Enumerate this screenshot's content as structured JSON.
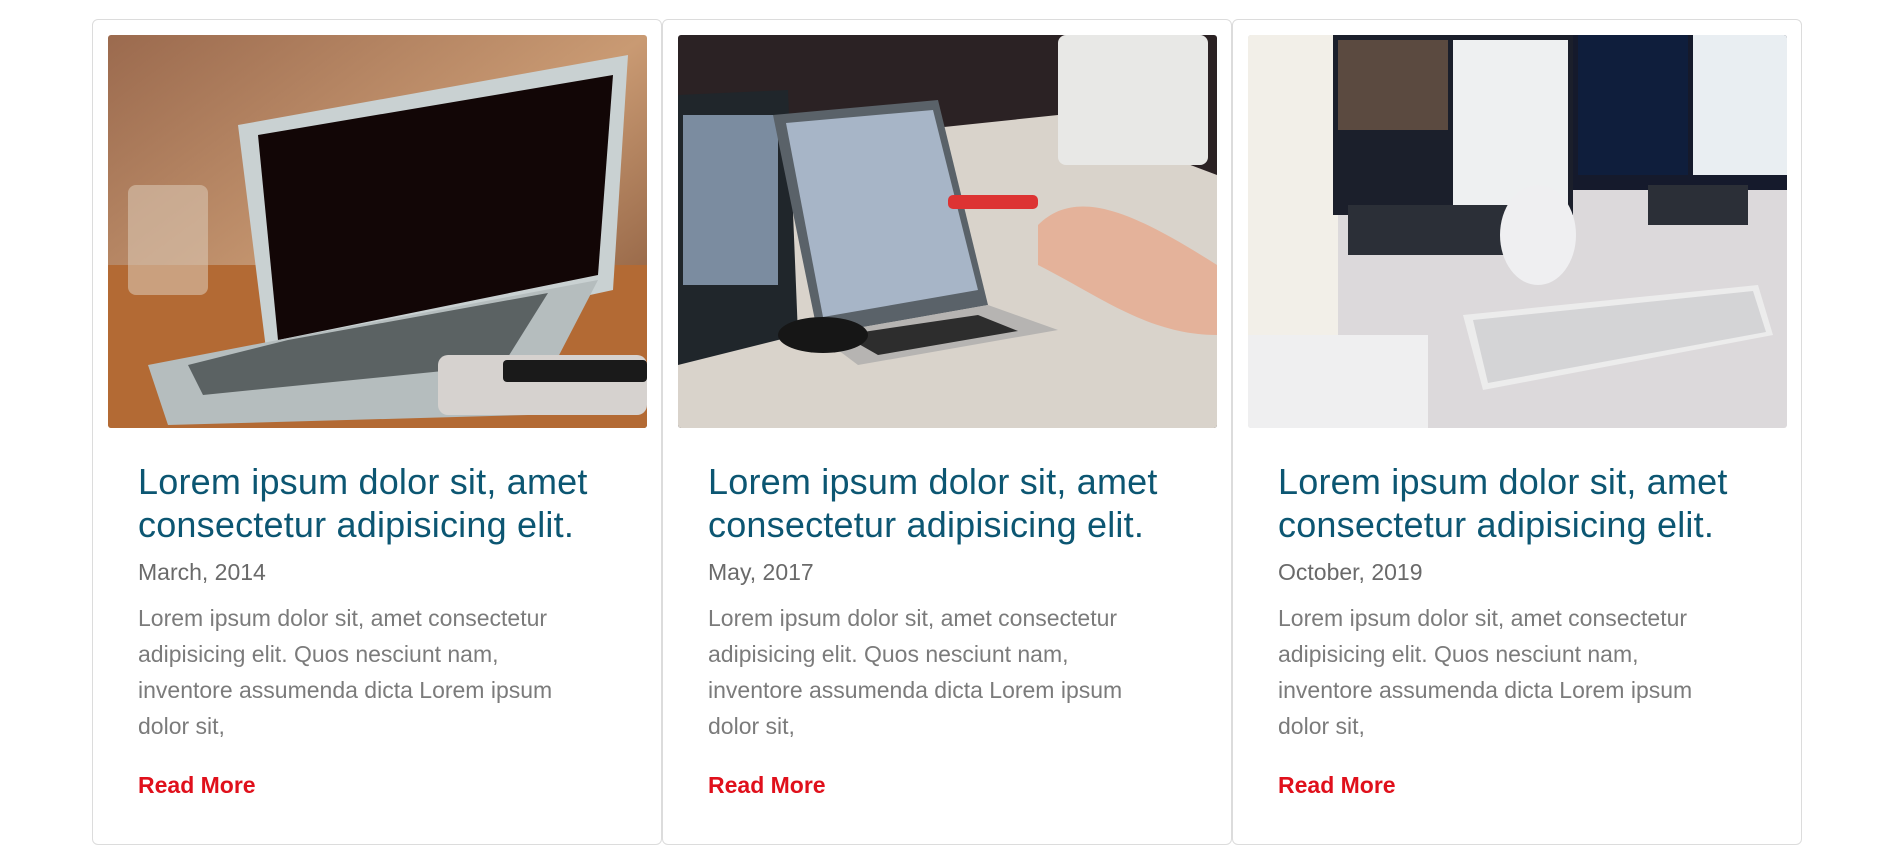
{
  "cards": [
    {
      "image": "laptop-on-wooden-table-photo",
      "title": "Lorem ipsum dolor sit, amet consectetur adipisicing elit.",
      "date": "March, 2014",
      "excerpt": "Lorem ipsum dolor sit, amet consectetur adipisicing elit. Quos nesciunt nam, inventore assumenda dicta Lorem ipsum dolor sit,",
      "link": "Read More"
    },
    {
      "image": "laptops-meeting-table-photo",
      "title": "Lorem ipsum dolor sit, amet consectetur adipisicing elit.",
      "date": "May, 2017",
      "excerpt": "Lorem ipsum dolor sit, amet consectetur adipisicing elit. Quos nesciunt nam, inventore assumenda dicta Lorem ipsum dolor sit,",
      "link": "Read More"
    },
    {
      "image": "desk-monitors-keyboard-photo",
      "title": "Lorem ipsum dolor sit, amet consectetur adipisicing elit.",
      "date": "October, 2019",
      "excerpt": "Lorem ipsum dolor sit, amet consectetur adipisicing elit. Quos nesciunt nam, inventore assumenda dicta Lorem ipsum dolor sit,",
      "link": "Read More"
    }
  ],
  "colors": {
    "title": "#0c5672",
    "date": "#6a6a6a",
    "excerpt": "#7b7b7b",
    "link": "#e0101b",
    "border": "#dcdcdc"
  }
}
